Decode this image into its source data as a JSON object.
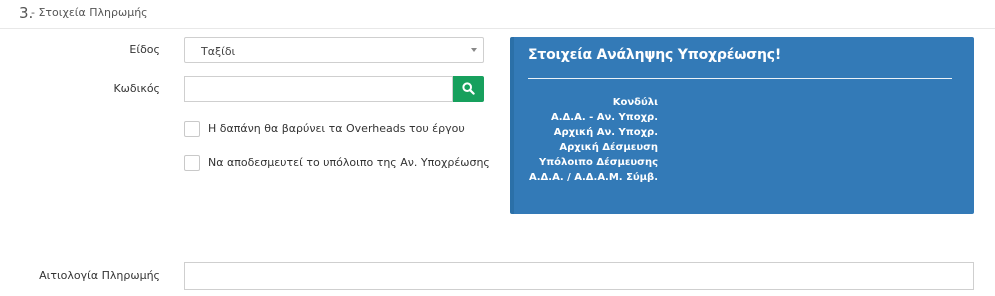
{
  "section": {
    "number": "3.",
    "title": "- Στοιχεία Πληρωμής"
  },
  "form": {
    "type_label": "Είδος",
    "type_value": "Ταξίδι",
    "code_label": "Κωδικός",
    "code_value": "",
    "search_icon": "search-icon",
    "checkbox_overheads_label": "Η δαπάνη θα βαρύνει τα Overheads του έργου",
    "checkbox_overheads_checked": false,
    "checkbox_release_label": "Να αποδεσμευτεί το υπόλοιπο της Αν. Υποχρέωσης",
    "checkbox_release_checked": false,
    "justification_label": "Αιτιολογία Πληρωμής",
    "justification_value": ""
  },
  "info_panel": {
    "title": "Στοιχεία Ανάληψης Υποχρέωσης!",
    "lines": [
      "Κονδύλι",
      "Α.Δ.Α. - Αν. Υποχρ.",
      "Αρχική Αν. Υποχρ.",
      "Αρχική Δέσμευση",
      "Υπόλοιπο Δέσμευσης",
      "Α.Δ.Α. / Α.Δ.Α.Μ. Σύμβ."
    ]
  },
  "colors": {
    "panel_bg": "#337ab7",
    "search_button": "#17a05d"
  }
}
